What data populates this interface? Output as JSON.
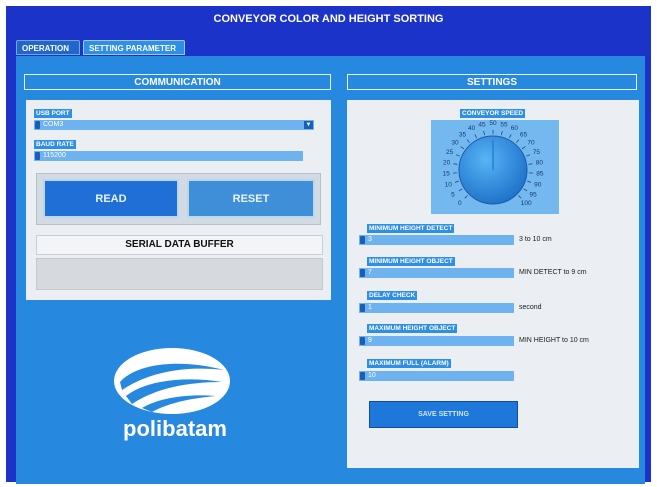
{
  "window": {
    "title": "CONVEYOR COLOR AND HEIGHT SORTING"
  },
  "tabs": [
    {
      "label": "OPERATION",
      "active": false
    },
    {
      "label": "SETTING PARAMETER",
      "active": true
    }
  ],
  "communication": {
    "header": "COMMUNICATION",
    "usb_port": {
      "label": "USB PORT",
      "value": "COM3"
    },
    "baud_rate": {
      "label": "BAUD RATE",
      "value": "115200"
    },
    "read_label": "READ",
    "reset_label": "RESET",
    "serial_buffer_label": "SERIAL DATA BUFFER",
    "serial_buffer_value": ""
  },
  "settings": {
    "header": "SETTINGS",
    "conveyor_speed": {
      "label": "CONVEYOR SPEED",
      "ticks": [
        "0",
        "5",
        "10",
        "15",
        "20",
        "25",
        "30",
        "35",
        "40",
        "45",
        "50",
        "55",
        "60",
        "65",
        "70",
        "75",
        "80",
        "85",
        "90",
        "95",
        "100"
      ]
    },
    "min_height_detect": {
      "label": "MINIMUM HEIGHT DETECT",
      "value": "3",
      "unit": "3 to 10 cm"
    },
    "min_height_object": {
      "label": "MINIMUM HEIGHT OBJECT",
      "value": "7",
      "unit": "MIN DETECT to 9 cm"
    },
    "delay_check": {
      "label": "DELAY CHECK",
      "value": "1",
      "unit": "second"
    },
    "max_height_object": {
      "label": "MAXIMUM HEIGHT OBJECT",
      "value": "9",
      "unit": "MIN HEIGHT to 10 cm"
    },
    "max_full_alarm": {
      "label": "MAXIMUM FULL (ALARM)",
      "value": "10"
    },
    "save_label": "SAVE SETTING"
  },
  "logo": {
    "text": "polibatam"
  },
  "colors": {
    "frame": "#1b33c9",
    "panel": "#2688df",
    "field": "#6fb2f0",
    "button": "#1e78dc",
    "knob": "#2f96ea"
  }
}
